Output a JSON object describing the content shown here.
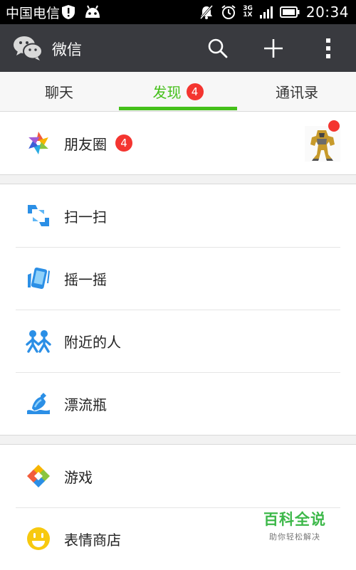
{
  "status_bar": {
    "carrier": "中国电信",
    "time": "20:34",
    "network_top": "3G",
    "network_bottom": "1X"
  },
  "app_bar": {
    "title": "微信"
  },
  "tabs": [
    {
      "label": "聊天"
    },
    {
      "label": "发现",
      "badge": "4",
      "active": true
    },
    {
      "label": "通讯录"
    }
  ],
  "menu": {
    "moments": {
      "label": "朋友圈",
      "badge": "4"
    },
    "scan": {
      "label": "扫一扫"
    },
    "shake": {
      "label": "摇一摇"
    },
    "nearby": {
      "label": "附近的人"
    },
    "bottle": {
      "label": "漂流瓶"
    },
    "games": {
      "label": "游戏"
    },
    "stickers": {
      "label": "表情商店"
    }
  },
  "watermark": {
    "line1": "百科全说",
    "line2": "助你轻松解决"
  },
  "colors": {
    "accent": "#45c01a",
    "badge": "#f43530",
    "appbar": "#393a3f"
  }
}
